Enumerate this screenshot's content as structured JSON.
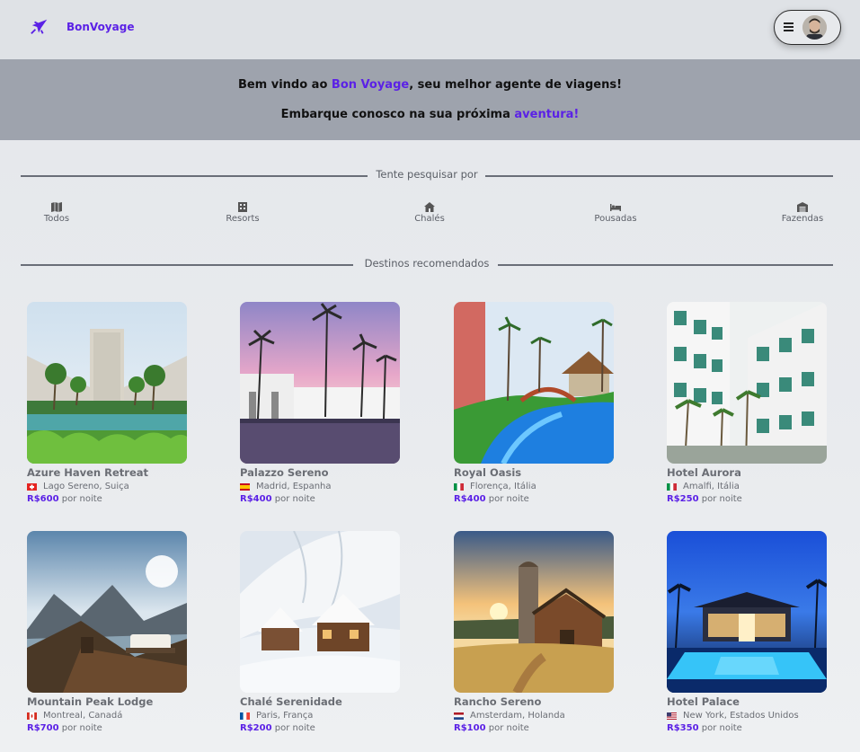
{
  "header": {
    "brand": "BonVoyage",
    "logo_icon": "airplane-icon",
    "menu_icon": "hamburger-icon"
  },
  "banner": {
    "line1_pre": "Bem vindo ao ",
    "line1_accent": "Bon Voyage",
    "line1_post": ", seu melhor agente de viagens!",
    "line2_pre": "Embarque conosco na sua próxima ",
    "line2_accent": "aventura!"
  },
  "search_section": {
    "label": "Tente pesquisar por"
  },
  "categories": [
    {
      "label": "Todos",
      "icon": "map-icon"
    },
    {
      "label": "Resorts",
      "icon": "building-icon"
    },
    {
      "label": "Chalés",
      "icon": "house-icon"
    },
    {
      "label": "Pousadas",
      "icon": "bed-icon"
    },
    {
      "label": "Fazendas",
      "icon": "warehouse-icon"
    }
  ],
  "recommended_section": {
    "label": "Destinos recomendados"
  },
  "price_suffix": "por noite",
  "destinations": [
    {
      "name": "Azure Haven Retreat",
      "location": "Lago Sereno, Suiça",
      "price": "R$600",
      "flag": "switzerland"
    },
    {
      "name": "Palazzo Sereno",
      "location": "Madrid, Espanha",
      "price": "R$400",
      "flag": "spain"
    },
    {
      "name": "Royal Oasis",
      "location": "Florença, Itália",
      "price": "R$400",
      "flag": "italy"
    },
    {
      "name": "Hotel Aurora",
      "location": "Amalfi, Itália",
      "price": "R$250",
      "flag": "italy"
    },
    {
      "name": "Mountain Peak Lodge",
      "location": "Montreal, Canadá",
      "price": "R$700",
      "flag": "canada"
    },
    {
      "name": "Chalé Serenidade",
      "location": "Paris, França",
      "price": "R$200",
      "flag": "france"
    },
    {
      "name": "Rancho Sereno",
      "location": "Amsterdam, Holanda",
      "price": "R$100",
      "flag": "netherlands"
    },
    {
      "name": "Hotel Palace",
      "location": "New York, Estados Unidos",
      "price": "R$350",
      "flag": "usa"
    }
  ],
  "colors": {
    "accent": "#5b21e6",
    "banner": "#9ea3ad"
  }
}
